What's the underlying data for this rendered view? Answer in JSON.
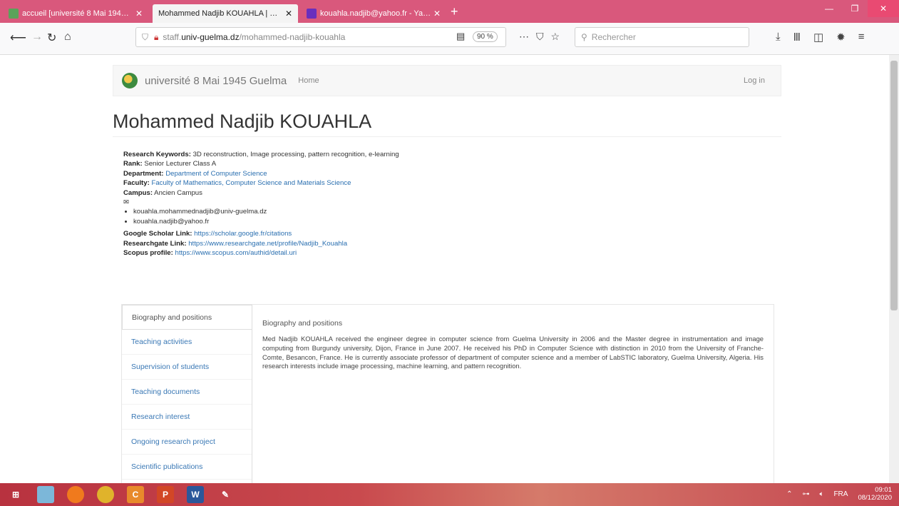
{
  "browser": {
    "tabs": [
      {
        "title": "accueil [université 8 Mai 194…",
        "active": false
      },
      {
        "title": "Mohammed Nadjib KOUAHLA | …",
        "active": true
      },
      {
        "title": "kouahla.nadjib@yahoo.fr - Ya…",
        "active": false
      }
    ],
    "url_prefix": "staff.",
    "url_host": "univ-guelma.dz",
    "url_path": "/mohammed-nadjib-kouahla",
    "zoom": "90 %",
    "search_placeholder": "Rechercher"
  },
  "site": {
    "brand": "université 8 Mai 1945 Guelma",
    "home": "Home",
    "login": "Log in"
  },
  "profile": {
    "name": "Mohammed Nadjib KOUAHLA",
    "keywords_label": "Research Keywords:",
    "keywords": " 3D reconstruction, Image processing, pattern recognition, e-learning",
    "rank_label": "Rank:",
    "rank": " Senior Lecturer Class A",
    "department_label": "Department:",
    "department": "Department of Computer Science",
    "faculty_label": "Faculty:",
    "faculty": "Faculty of Mathematics, Computer Science and Materials Science",
    "campus_label": "Campus:",
    "campus": " Ancien Campus",
    "emails": [
      "kouahla.mohammednadjib@univ-guelma.dz",
      "kouahla.nadjib@yahoo.fr"
    ],
    "scholar_label": "Google Scholar Link:",
    "scholar": "https://scholar.google.fr/citations",
    "researchgate_label": "Researchgate Link:",
    "researchgate": "https://www.researchgate.net/profile/Nadjib_Kouahla",
    "scopus_label": "Scopus profile:",
    "scopus": "https://www.scopus.com/authid/detail.uri"
  },
  "tabs": [
    "Biography and positions",
    "Teaching activities",
    "Supervision of students",
    "Teaching documents",
    "Research interest",
    "Ongoing research project",
    "Scientific publications"
  ],
  "panel": {
    "title": "Biography and positions",
    "text": "Med Nadjib KOUAHLA received the engineer degree in computer science from Guelma University in 2006 and the Master degree in instrumentation and image computing from Burgundy university, Dijon, France in June 2007. He received his PhD in Computer Science with distinction in 2010 from the University of Franche-Comte, Besancon, France. He is currently associate professor of department of computer science and a member of LabSTIC laboratory, Guelma University, Algeria. His research interests include image processing, machine learning, and pattern recognition."
  },
  "taskbar": {
    "lang": "FRA",
    "time": "09:01",
    "date": "08/12/2020"
  }
}
